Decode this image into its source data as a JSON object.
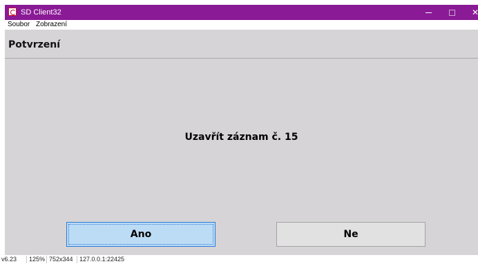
{
  "window": {
    "title": "SD Client32",
    "controls": {
      "minimize": "minimize-icon",
      "maximize": "maximize-icon",
      "close": "close-icon"
    }
  },
  "menu": {
    "items": [
      "Soubor",
      "Zobrazení"
    ]
  },
  "header": {
    "title": "Potvrzení"
  },
  "dialog": {
    "message": "Uzavřít záznam č. 15"
  },
  "buttons": {
    "yes": "Ano",
    "no": "Ne"
  },
  "statusbar": {
    "version": "v6.23",
    "zoom": "125%",
    "size": "752x344",
    "address": "127.0.0.1:22425"
  },
  "colors": {
    "titlebar": "#8a1a96",
    "background": "#d6d4d6",
    "focused_button": "#bcdcf5"
  }
}
